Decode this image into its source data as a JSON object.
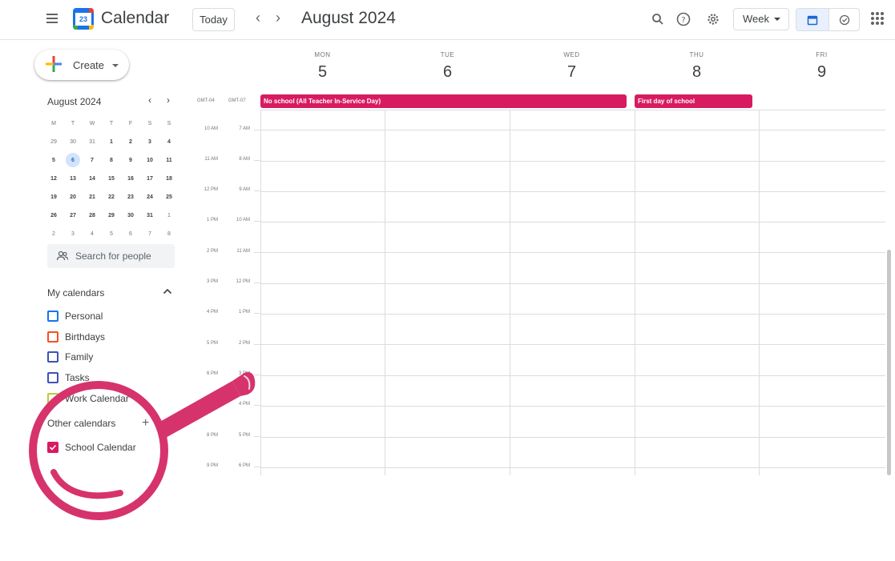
{
  "header": {
    "app_name": "Calendar",
    "logo_day": "23",
    "today_label": "Today",
    "prev_icon": "chevron-left-icon",
    "next_icon": "chevron-right-icon",
    "month_title": "August 2024",
    "view_label": "Week",
    "icons": [
      "search-icon",
      "help-icon",
      "settings-icon",
      "calendar-view-icon",
      "tasks-view-icon",
      "apps-grid-icon"
    ]
  },
  "sidebar": {
    "create_label": "Create",
    "mini_calendar": {
      "title": "August 2024",
      "weekday_initials": [
        "M",
        "T",
        "W",
        "T",
        "F",
        "S",
        "S"
      ],
      "weeks": [
        [
          "29",
          "30",
          "31",
          "1",
          "2",
          "3",
          "4"
        ],
        [
          "5",
          "6",
          "7",
          "8",
          "9",
          "10",
          "11"
        ],
        [
          "12",
          "13",
          "14",
          "15",
          "16",
          "17",
          "18"
        ],
        [
          "19",
          "20",
          "21",
          "22",
          "23",
          "24",
          "25"
        ],
        [
          "26",
          "27",
          "28",
          "29",
          "30",
          "31",
          "1"
        ],
        [
          "2",
          "3",
          "4",
          "5",
          "6",
          "7",
          "8"
        ]
      ],
      "selected_day": "6"
    },
    "search_people_placeholder": "Search for people",
    "my_calendars_title": "My calendars",
    "my_calendars": [
      {
        "label": "Personal",
        "color": "#1a73e8"
      },
      {
        "label": "Birthdays",
        "color": "#f4511e"
      },
      {
        "label": "Family",
        "color": "#3f51b5"
      },
      {
        "label": "Tasks",
        "color": "#3f51b5"
      },
      {
        "label": "Work Calendar",
        "color": "#c0ca33"
      }
    ],
    "other_calendars_title": "Other calendars",
    "other_calendars": [
      {
        "label": "School Calendar",
        "color": "#d81b60",
        "checked": true
      }
    ]
  },
  "week": {
    "timezones": [
      "GMT-04",
      "GMT-07"
    ],
    "days": [
      {
        "dow": "MON",
        "num": "5"
      },
      {
        "dow": "TUE",
        "num": "6"
      },
      {
        "dow": "WED",
        "num": "7"
      },
      {
        "dow": "THU",
        "num": "8"
      },
      {
        "dow": "FRI",
        "num": "9"
      }
    ],
    "all_day_events": [
      {
        "title": "No school (All Teacher In-Service Day)",
        "color": "#d81b60"
      },
      {
        "title": "First day of school",
        "color": "#d81b60"
      }
    ],
    "time_labels_primary": [
      "10 AM",
      "11 AM",
      "12 PM",
      "1 PM",
      "2 PM",
      "3 PM",
      "4 PM",
      "5 PM",
      "6 PM",
      "7 PM",
      "8 PM",
      "9 PM"
    ],
    "time_labels_secondary": [
      "7 AM",
      "8 AM",
      "9 AM",
      "10 AM",
      "11 AM",
      "12 PM",
      "1 PM",
      "2 PM",
      "3 PM",
      "4 PM",
      "5 PM",
      "6 PM"
    ]
  },
  "colors": {
    "accent": "#1a73e8",
    "school": "#d81b60",
    "magnifier": "#d6336c"
  }
}
